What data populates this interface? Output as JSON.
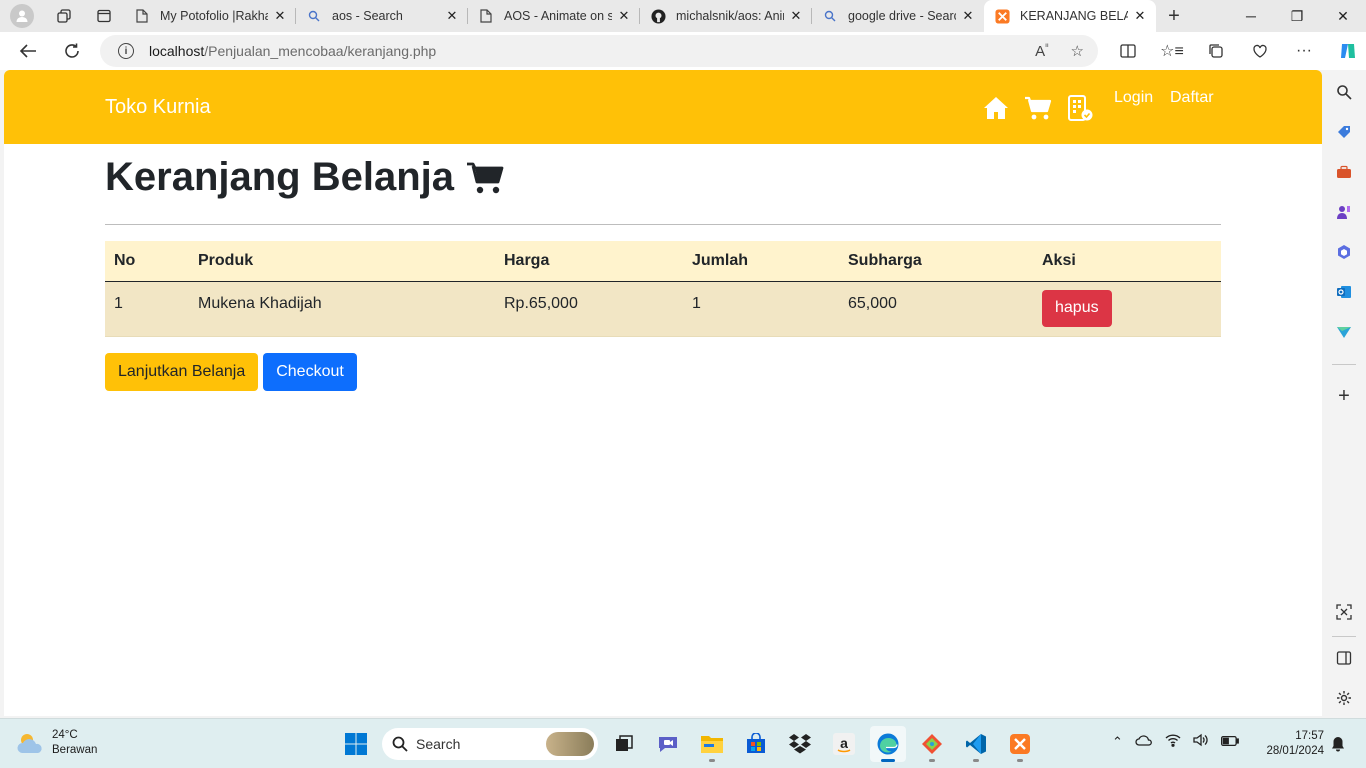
{
  "browser": {
    "tabs": [
      {
        "title": "My Potofolio |Rakha",
        "icon": "document-icon"
      },
      {
        "title": "aos - Search",
        "icon": "search-icon"
      },
      {
        "title": "AOS - Animate on scroll",
        "icon": "document-icon"
      },
      {
        "title": "michalsnik/aos: Animate",
        "icon": "github-icon"
      },
      {
        "title": "google drive - Search",
        "icon": "search-icon"
      },
      {
        "title": "KERANJANG BELANJA",
        "icon": "xampp-icon"
      }
    ],
    "address": {
      "host": "localhost",
      "path": "/Penjualan_mencobaa/keranjang.php"
    }
  },
  "site": {
    "brand": "Toko Kurnia",
    "nav": {
      "login": "Login",
      "daftar": "Daftar",
      "icons": [
        "home-icon",
        "cart-icon",
        "order-list-icon"
      ]
    },
    "accent_color": "#ffc107"
  },
  "cart": {
    "title": "Keranjang Belanja",
    "columns": [
      "No",
      "Produk",
      "Harga",
      "Jumlah",
      "Subharga",
      "Aksi"
    ],
    "rows": [
      {
        "no": "1",
        "produk": "Mukena Khadijah",
        "harga": "Rp.65,000",
        "jumlah": "1",
        "subharga": "65,000",
        "aksi": "hapus"
      }
    ],
    "buttons": {
      "continue": "Lanjutkan Belanja",
      "checkout": "Checkout"
    }
  },
  "taskbar": {
    "weather": {
      "temp": "24°C",
      "condition": "Berawan"
    },
    "search_placeholder": "Search",
    "time": "17:57",
    "date": "28/01/2024"
  }
}
